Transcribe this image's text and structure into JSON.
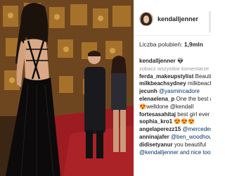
{
  "post": {
    "username": "kendalljenner",
    "likes_label": "Liczba polubień:",
    "likes_count": "1,9mln",
    "caption": {
      "user": "kendalljenner",
      "text": "👽"
    },
    "load_more": "zobacz wszystkie komentarze",
    "comments": [
      {
        "user": "ferda_makeupstylist",
        "text": "Beautiful"
      },
      {
        "user": "milkbeachsydney",
        "text": "milkbeach.c"
      },
      {
        "user": "jecunh",
        "text": "@yasmincadore"
      },
      {
        "user": "elenaelena_p",
        "text": "One the best at"
      },
      {
        "user": "",
        "text": "😍welldone @kendall"
      },
      {
        "user": "fortesasahitaj",
        "text": "best girl ever"
      },
      {
        "user": "sophia_kro1",
        "text": "😍😍😍"
      },
      {
        "user": "angelaperezz15",
        "text": "@mercedesp"
      },
      {
        "user": "anninajafer",
        "text": "@ben_woodhous"
      },
      {
        "user": "didisetyanur",
        "text": "you beautiful"
      },
      {
        "user": "",
        "text": "@kendalljenner and nice too"
      }
    ]
  },
  "colors": {
    "text": "#262626",
    "mention": "#003569",
    "muted": "#999999",
    "carpet": "#9c1c22",
    "backdrop": "#8a5b2a",
    "dress": "#0c0a0a"
  }
}
